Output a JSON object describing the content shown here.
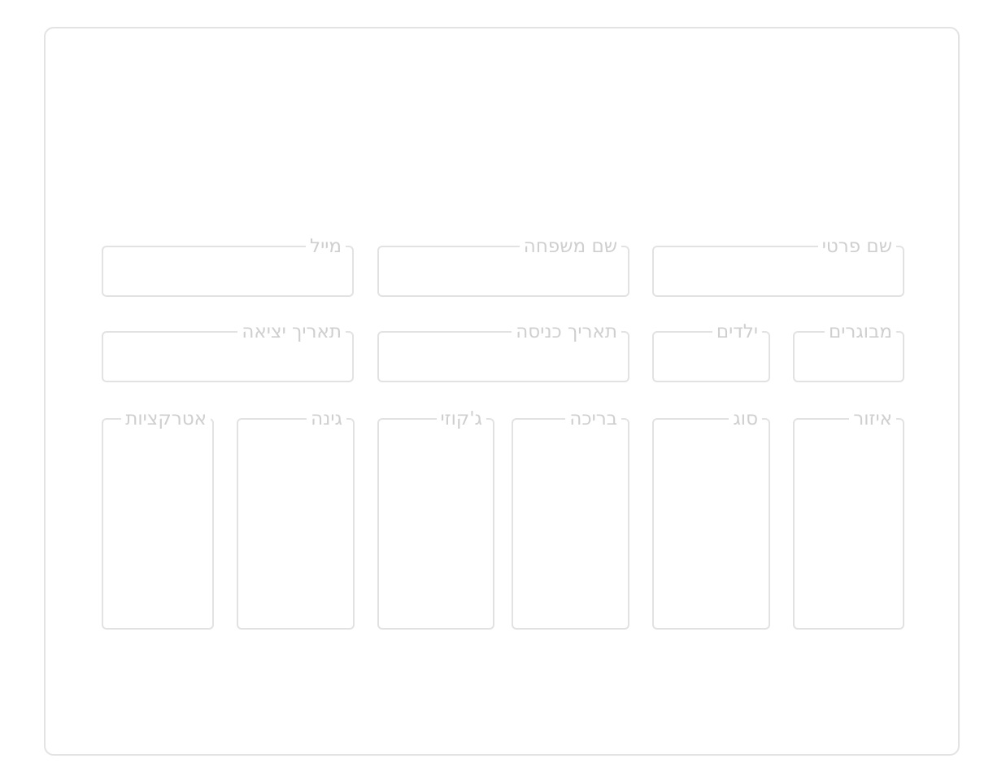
{
  "form": {
    "first_name": "שם פרטי",
    "last_name": "שם משפחה",
    "email": "מייל",
    "adults": "מבוגרים",
    "children": "ילדים",
    "check_in": "תאריך כניסה",
    "check_out": "תאריך יציאה",
    "region": "איזור",
    "type": "סוג",
    "pool": "בריכה",
    "jacuzzi": "ג'קוזי",
    "garden": "גינה",
    "attractions": "אטרקציות"
  },
  "colors": {
    "border": "#e2e2e2",
    "label": "#cfcfcf"
  }
}
